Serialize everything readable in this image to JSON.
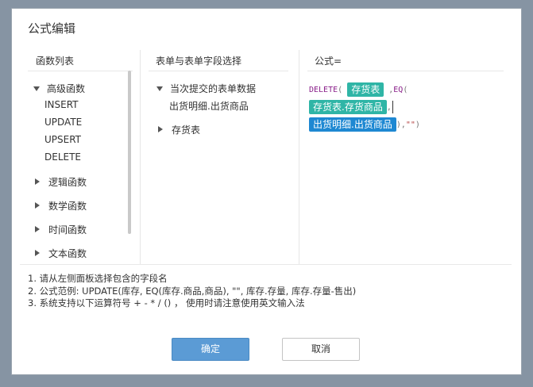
{
  "dialog": {
    "title": "公式编辑"
  },
  "functions_pane": {
    "header": "函数列表",
    "advanced": {
      "label": "高级函数",
      "items": [
        "INSERT",
        "UPDATE",
        "UPSERT",
        "DELETE"
      ]
    },
    "groups": [
      "逻辑函数",
      "数学函数",
      "时间函数",
      "文本函数"
    ]
  },
  "fields_pane": {
    "header": "表单与表单字段选择",
    "current": {
      "label": "当次提交的表单数据",
      "child": "出货明细.出货商品"
    },
    "other": "存货表"
  },
  "formula_pane": {
    "header": "公式=",
    "tokens": {
      "fn_delete": "DELETE",
      "paren_open": "(",
      "chip1": "存货表",
      "comma_eq": ",",
      "fn_eq": "EQ",
      "paren_open2": "(",
      "chip2": "存货表.存货商品",
      "comma2": ",",
      "chip3": "出货明细.出货商品",
      "tail_punc": "),",
      "tail_str": "\"\"",
      "tail_close": ")"
    }
  },
  "hints": [
    "1. 请从左侧面板选择包含的字段名",
    "2. 公式范例: UPDATE(库存, EQ(库存.商品,商品), \"\", 库存.存量, 库存.存量-售出)",
    "3. 系统支持以下运算符号 + - * / () ， 使用时请注意使用英文输入法"
  ],
  "buttons": {
    "ok": "确定",
    "cancel": "取消"
  },
  "colors": {
    "chip_teal": "#2fb5a6",
    "chip_blue": "#1e88d2",
    "ok_button": "#5b9bd5",
    "backdrop": "#8694a3"
  }
}
